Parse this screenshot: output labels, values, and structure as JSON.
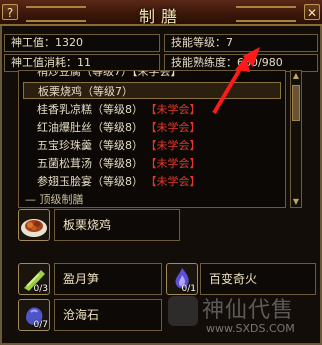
{
  "window": {
    "title": "制膳",
    "help_glyph": "?",
    "close_glyph": "✕"
  },
  "stats": {
    "value_label": "神工值：1320",
    "level_label": "技能等级：7",
    "cost_label": "神工值消耗：11",
    "proficiency_label": "技能熟练度：680/980"
  },
  "recipes": {
    "partial_top": "稍炒豆腐（等级7）【未学会】",
    "items": [
      {
        "name": "板栗烧鸡（等级7）",
        "req": ""
      },
      {
        "name": "桂香乳凉糕（等级8）",
        "req": "【未学会】"
      },
      {
        "name": "红油爆肚丝（等级8）",
        "req": "【未学会】"
      },
      {
        "name": "五宝珍珠羹（等级8）",
        "req": "【未学会】"
      },
      {
        "name": "五菌松茸汤（等级8）",
        "req": "【未学会】"
      },
      {
        "name": "参翅玉脍宴（等级8）",
        "req": "【未学会】"
      }
    ],
    "section_header": "— 顶级制膳"
  },
  "result": {
    "name": "板栗烧鸡",
    "icon": "dish-icon"
  },
  "materials": [
    {
      "name": "盈月笋",
      "count": "0/3",
      "icon": "bamboo-shoot-icon"
    },
    {
      "name": "百变奇火",
      "count": "0/1",
      "icon": "fire-icon"
    },
    {
      "name": "沧海石",
      "count": "0/7",
      "icon": "stone-icon"
    }
  ],
  "watermark": {
    "cn": "神仙代售",
    "url": "www.SXDS.COM"
  },
  "colors": {
    "accent_red": "#e23a2a",
    "frame_gold": "#a78541"
  }
}
